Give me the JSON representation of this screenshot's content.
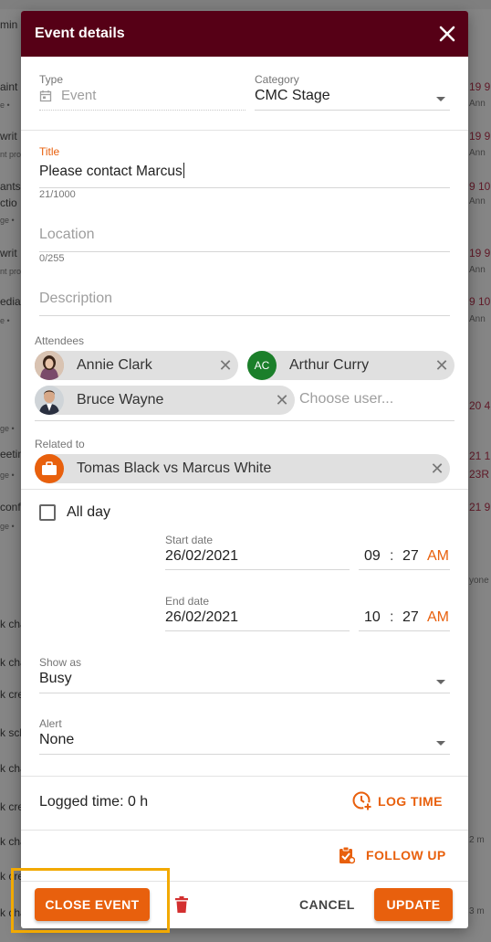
{
  "background": {
    "left_fragments": [
      "min",
      "aint S",
      "e •",
      "writ",
      "nt pro",
      "ants",
      "ctio",
      "ge •",
      "writ",
      "nt pro",
      "ediat",
      "e •",
      "ge •",
      "eetin",
      "ge •",
      "conf",
      "ge •",
      "k cha",
      "k cha",
      "k cre",
      "k sch",
      "k cha",
      "k cre",
      "k cha",
      "k cre",
      "k cha"
    ],
    "right_fragments": [
      "19 9",
      "Ann",
      "19 9",
      "Ann",
      "9 10",
      "Ann",
      "19 9",
      "Ann",
      "9 10",
      "Ann",
      "20 4",
      "21 12",
      "23R",
      "21 9",
      "yone",
      "2 m",
      "3 m"
    ]
  },
  "modal": {
    "title": "Event details",
    "close_icon": "close-icon",
    "type": {
      "label": "Type",
      "value": "Event",
      "icon": "calendar-icon"
    },
    "category": {
      "label": "Category",
      "value": "CMC Stage"
    },
    "title_field": {
      "label": "Title",
      "value": "Please contact Marcus",
      "counter": "21/1000"
    },
    "location": {
      "placeholder": "Location",
      "counter": "0/255"
    },
    "description": {
      "placeholder": "Description"
    },
    "attendees": {
      "label": "Attendees",
      "chips": [
        {
          "name": "Annie Clark",
          "avatar": "photo"
        },
        {
          "name": "Arthur Curry",
          "initials": "AC",
          "color": "#1b7f2a"
        },
        {
          "name": "Bruce Wayne",
          "avatar": "photo"
        }
      ],
      "placeholder": "Choose user..."
    },
    "related_to": {
      "label": "Related to",
      "value": "Tomas Black vs Marcus White",
      "icon": "briefcase-icon"
    },
    "all_day": {
      "label": "All day",
      "checked": false
    },
    "start": {
      "label": "Start date",
      "date": "26/02/2021",
      "hour": "09",
      "minute": "27",
      "ampm": "AM"
    },
    "end": {
      "label": "End date",
      "date": "26/02/2021",
      "hour": "10",
      "minute": "27",
      "ampm": "AM"
    },
    "show_as": {
      "label": "Show as",
      "value": "Busy"
    },
    "alert": {
      "label": "Alert",
      "value": "None"
    },
    "logged_time": "Logged time: 0 h",
    "log_time_label": "LOG TIME",
    "follow_up_label": "FOLLOW UP",
    "footer": {
      "close_event": "CLOSE EVENT",
      "cancel": "CANCEL",
      "update": "UPDATE"
    }
  },
  "colors": {
    "header": "#560016",
    "accent": "#e8600d",
    "highlight": "#f2a900"
  }
}
